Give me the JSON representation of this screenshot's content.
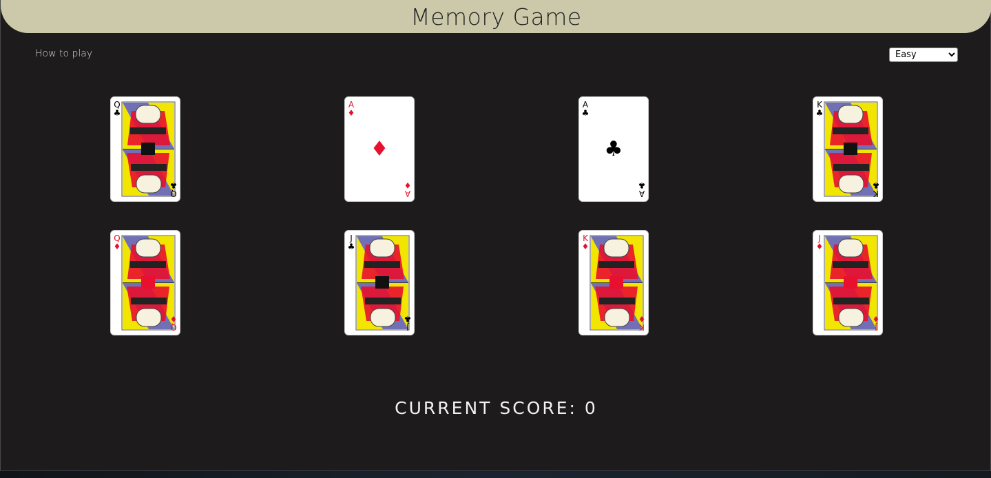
{
  "header": {
    "title": "Memory Game"
  },
  "controls": {
    "how_to_play": "How to play",
    "difficulty_selected": "Easy",
    "difficulty_options": [
      "Easy"
    ]
  },
  "cards": [
    {
      "rank": "Q",
      "suit": "♣",
      "color": "black",
      "face": true
    },
    {
      "rank": "A",
      "suit": "♦",
      "color": "red",
      "face": false
    },
    {
      "rank": "A",
      "suit": "♣",
      "color": "black",
      "face": false
    },
    {
      "rank": "K",
      "suit": "♣",
      "color": "black",
      "face": true
    },
    {
      "rank": "Q",
      "suit": "♦",
      "color": "red",
      "face": true
    },
    {
      "rank": "J",
      "suit": "♣",
      "color": "black",
      "face": true
    },
    {
      "rank": "K",
      "suit": "♦",
      "color": "red",
      "face": true
    },
    {
      "rank": "J",
      "suit": "♦",
      "color": "red",
      "face": true
    }
  ],
  "score": {
    "text": "CURRENT SCORE: 0"
  },
  "colors": {
    "header_bg": "#cbc9aa",
    "page_bg": "#1d1b1c",
    "red_suit": "#e8102e",
    "face_blue": "#5b5bd6",
    "face_yellow": "#f2e600",
    "face_red": "#e8102e"
  }
}
